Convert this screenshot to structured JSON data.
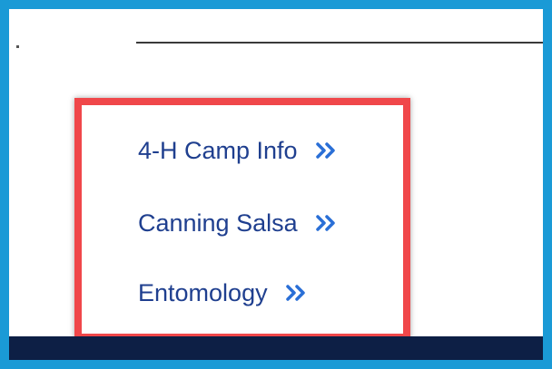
{
  "links": {
    "items": [
      {
        "label": "4-H Camp Info",
        "icon": "double-chevron-right-icon"
      },
      {
        "label": "Canning Salsa",
        "icon": "double-chevron-right-icon"
      },
      {
        "label": "Entomology",
        "icon": "double-chevron-right-icon"
      }
    ]
  },
  "colors": {
    "frame": "#1a9ad6",
    "highlight": "#f0474a",
    "link_text": "#1f3f8f",
    "chevron": "#2a6fd6",
    "footer": "#0d1f45"
  }
}
